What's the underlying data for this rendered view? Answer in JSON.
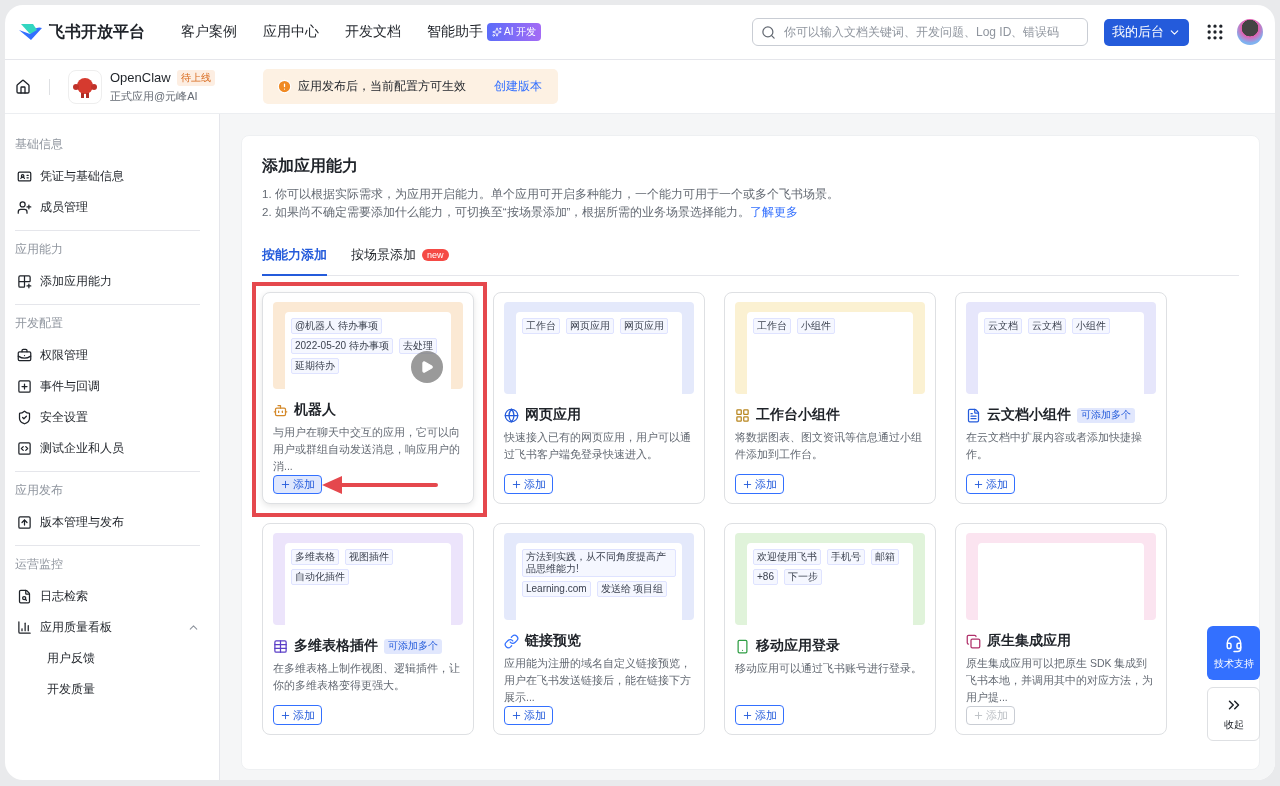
{
  "header": {
    "logo": "飞书开放平台",
    "nav": [
      "客户案例",
      "应用中心",
      "开发文档",
      "智能助手"
    ],
    "ai_badge": "AI 开发",
    "search": {
      "placeholder": "你可以输入文档关键词、开发问题、Log ID、错误码"
    },
    "console_button": "我的后台"
  },
  "app": {
    "name": "OpenClaw",
    "status": "待上线",
    "subtitle": "正式应用@元峰AI"
  },
  "notice": {
    "text": "应用发布后，当前配置方可生效",
    "link": "创建版本"
  },
  "sidebar": {
    "sections": [
      {
        "title": "基础信息",
        "items": [
          {
            "label": "凭证与基础信息"
          },
          {
            "label": "成员管理"
          }
        ]
      },
      {
        "title": "应用能力",
        "items": [
          {
            "label": "添加应用能力"
          }
        ]
      },
      {
        "title": "开发配置",
        "items": [
          {
            "label": "权限管理"
          },
          {
            "label": "事件与回调"
          },
          {
            "label": "安全设置"
          },
          {
            "label": "测试企业和人员"
          }
        ]
      },
      {
        "title": "应用发布",
        "items": [
          {
            "label": "版本管理与发布"
          }
        ]
      },
      {
        "title": "运营监控",
        "items": [
          {
            "label": "日志检索"
          },
          {
            "label": "应用质量看板",
            "expanded": true,
            "children": [
              {
                "label": "用户反馈"
              },
              {
                "label": "开发质量"
              }
            ]
          }
        ]
      }
    ]
  },
  "page": {
    "title": "添加应用能力",
    "notes": [
      "1. 你可以根据实际需求，为应用开启能力。单个应用可开启多种能力，一个能力可用于一个或多个飞书场景。",
      "2. 如果尚不确定需要添加什么能力，可切换至“按场景添加”，根据所需的业务场景选择能力。"
    ],
    "learn_more": "了解更多"
  },
  "tabs": [
    {
      "label": "按能力添加",
      "selected": true
    },
    {
      "label": "按场景添加",
      "selected": false,
      "badge": "new"
    }
  ],
  "cards": [
    {
      "title": "机器人",
      "desc": "与用户在聊天中交互的应用，它可以向用户或群组自动发送消息，响应用户的消...",
      "add": "添加",
      "disabled": false,
      "highlighted": true,
      "preview": [
        "@机器人 待办事项",
        "2022-05-20 待办事项",
        "去处理",
        "延期待办"
      ]
    },
    {
      "title": "网页应用",
      "desc": "快速接入已有的网页应用，用户可以通过飞书客户端免登录快速进入。",
      "add": "添加",
      "disabled": false,
      "highlighted": false,
      "preview": [
        "工作台",
        "网页应用",
        "网页应用"
      ]
    },
    {
      "title": "工作台小组件",
      "desc": "将数据图表、图文资讯等信息通过小组件添加到工作台。",
      "add": "添加",
      "disabled": false,
      "highlighted": false,
      "preview": [
        "工作台",
        "小组件"
      ]
    },
    {
      "title": "云文档小组件",
      "badge": "可添加多个",
      "desc": "在云文档中扩展内容或者添加快捷操作。",
      "add": "添加",
      "disabled": false,
      "highlighted": false,
      "preview": [
        "云文档",
        "云文档",
        "小组件"
      ]
    },
    {
      "title": "多维表格插件",
      "badge": "可添加多个",
      "desc": "在多维表格上制作视图、逻辑插件，让你的多维表格变得更强大。",
      "add": "添加",
      "disabled": false,
      "highlighted": false,
      "preview": [
        "多维表格",
        "视图插件",
        "自动化插件"
      ]
    },
    {
      "title": "链接预览",
      "desc": "应用能为注册的域名自定义链接预览，用户在飞书发送链接后，能在链接下方展示...",
      "add": "添加",
      "disabled": false,
      "highlighted": false,
      "preview": [
        "方法到实践，从不同角度提高产品思维能力!",
        "Learning.com",
        "发送给 项目组"
      ]
    },
    {
      "title": "移动应用登录",
      "desc": "移动应用可以通过飞书账号进行登录。",
      "add": "添加",
      "disabled": false,
      "highlighted": false,
      "preview": [
        "欢迎使用飞书",
        "手机号",
        "邮箱",
        "+86",
        "下一步"
      ]
    },
    {
      "title": "原生集成应用",
      "desc": "原生集成应用可以把原生 SDK 集成到飞书本地，并调用其中的对应方法，为用户提...",
      "add": "添加",
      "disabled": true,
      "highlighted": false
    }
  ],
  "float": {
    "support": "技术支持",
    "collapse": "收起"
  }
}
